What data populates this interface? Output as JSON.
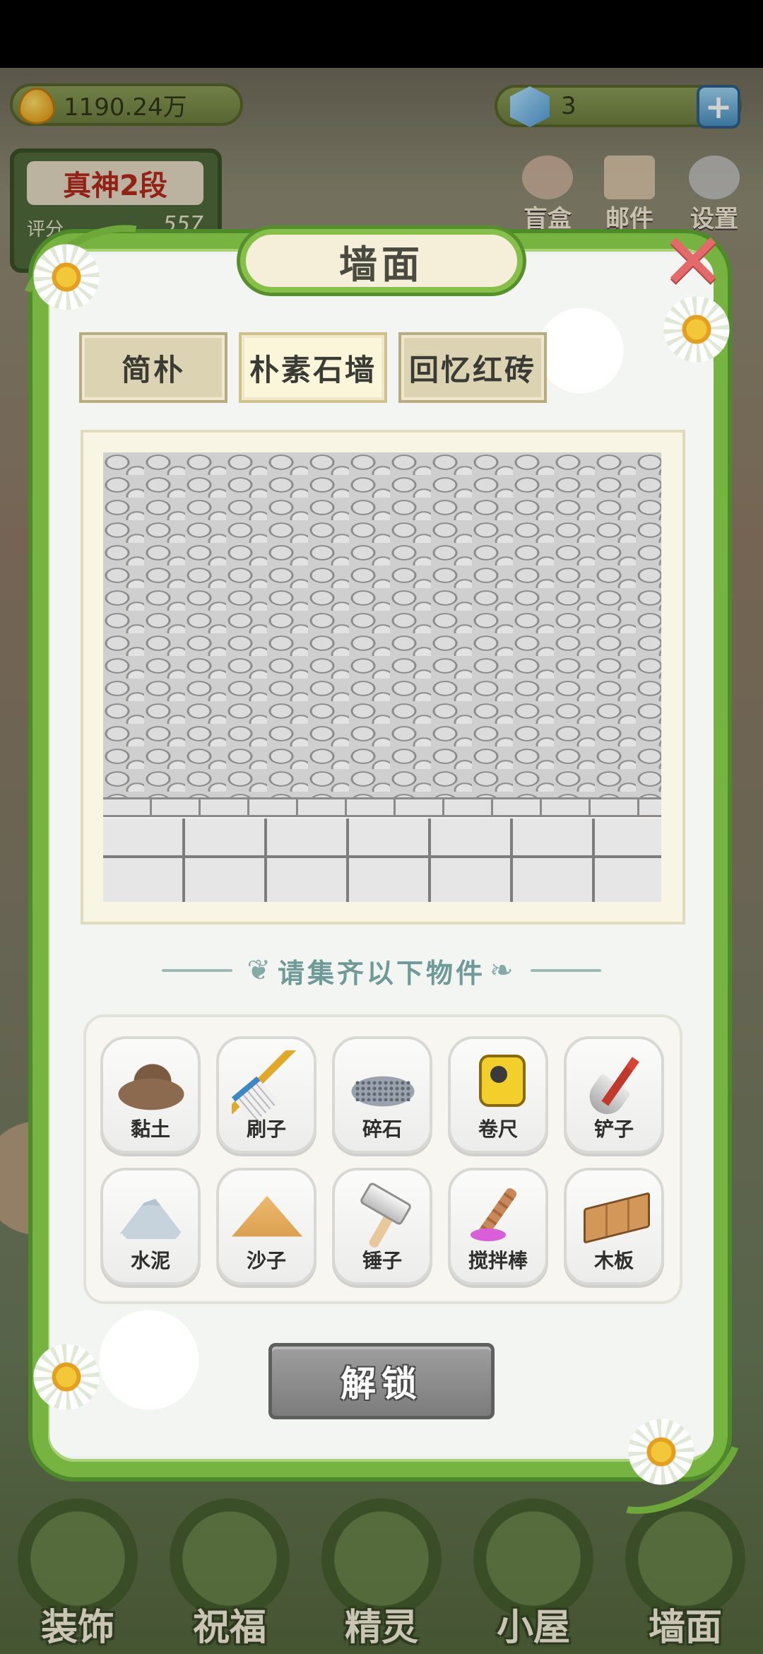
{
  "hud": {
    "gold_amount": "1190.24万",
    "gem_amount": "3",
    "plus_symbol": "+"
  },
  "rank": {
    "title": "真神2段",
    "score_label": "评分",
    "score": "557"
  },
  "top_icons": {
    "gift_label": "盲盒",
    "mail_label": "邮件",
    "settings_label": "设置"
  },
  "dialog": {
    "title": "墙面",
    "close_symbol": "✕",
    "tabs": [
      {
        "label": "简朴",
        "active": false
      },
      {
        "label": "朴素石墙",
        "active": true
      },
      {
        "label": "回忆红砖",
        "active": false
      }
    ],
    "collect_title": "请集齐以下物件",
    "items": [
      {
        "name": "黏土",
        "icon": "clay-icon"
      },
      {
        "name": "刷子",
        "icon": "brush-icon"
      },
      {
        "name": "碎石",
        "icon": "gravel-icon"
      },
      {
        "name": "卷尺",
        "icon": "tape-measure-icon"
      },
      {
        "name": "铲子",
        "icon": "shovel-icon"
      },
      {
        "name": "水泥",
        "icon": "cement-icon"
      },
      {
        "name": "沙子",
        "icon": "sand-icon"
      },
      {
        "name": "锤子",
        "icon": "hammer-icon"
      },
      {
        "name": "搅拌棒",
        "icon": "stir-stick-icon"
      },
      {
        "name": "木板",
        "icon": "wood-plank-icon"
      }
    ],
    "unlock_label": "解锁"
  },
  "bottom_nav": [
    {
      "label": "装饰"
    },
    {
      "label": "祝福"
    },
    {
      "label": "精灵"
    },
    {
      "label": "小屋"
    },
    {
      "label": "墙面"
    }
  ],
  "colors": {
    "frame_green": "#76b340",
    "button_gray": "#8a8a8a",
    "active_tab": "#fbf6d9"
  }
}
